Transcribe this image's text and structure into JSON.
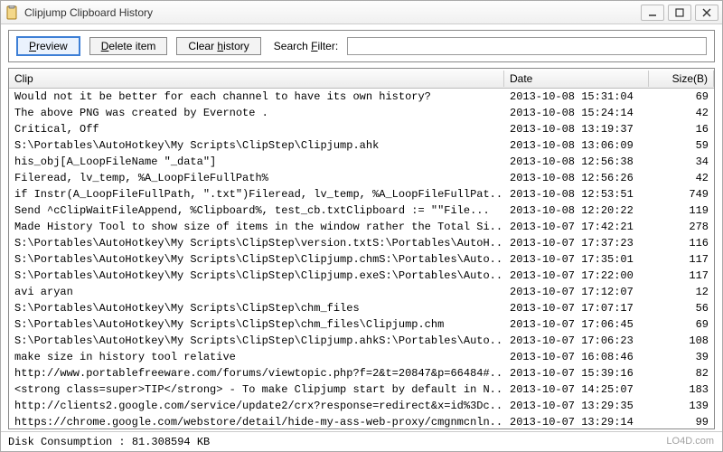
{
  "window": {
    "title": "Clipjump Clipboard History"
  },
  "toolbar": {
    "preview_label": "Preview",
    "delete_label": "Delete item",
    "clear_label": "Clear history",
    "filter_label": "Search Filter:",
    "filter_value": ""
  },
  "columns": {
    "clip": "Clip",
    "date": "Date",
    "size": "Size(B)"
  },
  "rows": [
    {
      "clip": "Would not it be better for each channel to have its own history?",
      "date": "2013-10-08  15:31:04",
      "size": 69
    },
    {
      "clip": "The above PNG was created by Evernote .",
      "date": "2013-10-08  15:24:14",
      "size": 42
    },
    {
      "clip": "Critical, Off",
      "date": "2013-10-08  13:19:37",
      "size": 16
    },
    {
      "clip": "S:\\Portables\\AutoHotkey\\My Scripts\\ClipStep\\Clipjump.ahk",
      "date": "2013-10-08  13:06:09",
      "size": 59
    },
    {
      "clip": "his_obj[A_LoopFileName \"_data\"]",
      "date": "2013-10-08  12:56:38",
      "size": 34
    },
    {
      "clip": "Fileread, lv_temp, %A_LoopFileFullPath%",
      "date": "2013-10-08  12:56:26",
      "size": 42
    },
    {
      "clip": "if Instr(A_LoopFileFullPath, \".txt\")Fileread, lv_temp, %A_LoopFileFullPat...",
      "date": "2013-10-08  12:53:51",
      "size": 749
    },
    {
      "clip": "Send ^cClipWaitFileAppend, %Clipboard%, test_cb.txtClipboard := \"\"File...",
      "date": "2013-10-08  12:20:22",
      "size": 119
    },
    {
      "clip": "Made History Tool to show size of items in the window rather the Total Si...",
      "date": "2013-10-07  17:42:21",
      "size": 278
    },
    {
      "clip": "S:\\Portables\\AutoHotkey\\My Scripts\\ClipStep\\version.txtS:\\Portables\\AutoH...",
      "date": "2013-10-07  17:37:23",
      "size": 116
    },
    {
      "clip": "S:\\Portables\\AutoHotkey\\My Scripts\\ClipStep\\Clipjump.chmS:\\Portables\\Auto...",
      "date": "2013-10-07  17:35:01",
      "size": 117
    },
    {
      "clip": "S:\\Portables\\AutoHotkey\\My Scripts\\ClipStep\\Clipjump.exeS:\\Portables\\Auto...",
      "date": "2013-10-07  17:22:00",
      "size": 117
    },
    {
      "clip": "avi aryan",
      "date": "2013-10-07  17:12:07",
      "size": 12
    },
    {
      "clip": "S:\\Portables\\AutoHotkey\\My Scripts\\ClipStep\\chm_files",
      "date": "2013-10-07  17:07:17",
      "size": 56
    },
    {
      "clip": "S:\\Portables\\AutoHotkey\\My Scripts\\ClipStep\\chm_files\\Clipjump.chm",
      "date": "2013-10-07  17:06:45",
      "size": 69
    },
    {
      "clip": "S:\\Portables\\AutoHotkey\\My Scripts\\ClipStep\\Clipjump.ahkS:\\Portables\\Auto...",
      "date": "2013-10-07  17:06:23",
      "size": 108
    },
    {
      "clip": "make size in history tool relative",
      "date": "2013-10-07  16:08:46",
      "size": 39
    },
    {
      "clip": "http://www.portablefreeware.com/forums/viewtopic.php?f=2&t=20847&p=66484#...",
      "date": "2013-10-07  15:39:16",
      "size": 82
    },
    {
      "clip": "<strong class=super>TIP</strong> - To make Clipjump start by default in N...",
      "date": "2013-10-07  14:25:07",
      "size": 183
    },
    {
      "clip": "http://clients2.google.com/service/update2/crx?response=redirect&x=id%3Dc...",
      "date": "2013-10-07  13:29:35",
      "size": 139
    },
    {
      "clip": "https://chrome.google.com/webstore/detail/hide-my-ass-web-proxy/cmgnmcnln...",
      "date": "2013-10-07  13:29:14",
      "size": 99
    }
  ],
  "status": {
    "disk_consumption": "Disk Consumption : 81.308594 KB"
  },
  "watermark": "LO4D.com"
}
